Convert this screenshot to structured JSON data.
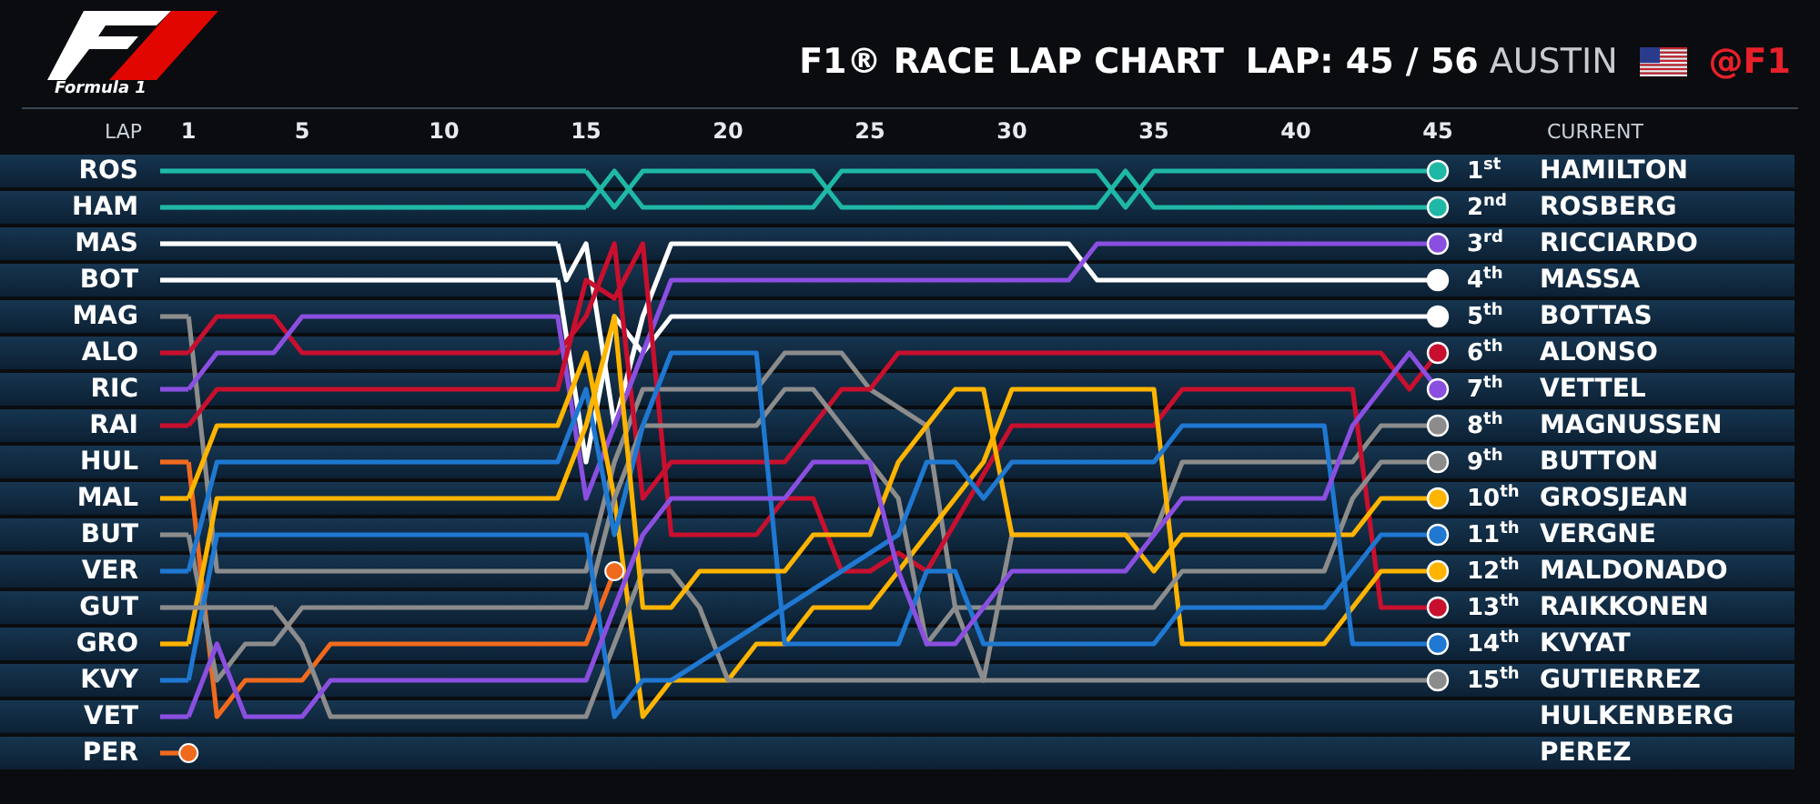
{
  "header": {
    "logo_caption": "Formula 1",
    "title": "F1® RACE LAP CHART",
    "lap_label": "LAP: 45 / 56",
    "venue": "AUSTIN",
    "handle": "@F1"
  },
  "chart": {
    "lap_heading": "LAP",
    "current_heading": "CURRENT",
    "lap_ticks": [
      "1",
      "5",
      "10",
      "15",
      "20",
      "25",
      "30",
      "35",
      "40",
      "45"
    ],
    "start_order": [
      {
        "code": "ROS",
        "color": "#1fb8a6"
      },
      {
        "code": "HAM",
        "color": "#1fb8a6"
      },
      {
        "code": "MAS",
        "color": "#ffffff"
      },
      {
        "code": "BOT",
        "color": "#ffffff"
      },
      {
        "code": "MAG",
        "color": "#8c8c8c"
      },
      {
        "code": "ALO",
        "color": "#c8102e"
      },
      {
        "code": "RIC",
        "color": "#8a4fe0"
      },
      {
        "code": "RAI",
        "color": "#c8102e"
      },
      {
        "code": "HUL",
        "color": "#f06a1e"
      },
      {
        "code": "MAL",
        "color": "#ffb400"
      },
      {
        "code": "BUT",
        "color": "#8c8c8c"
      },
      {
        "code": "VER",
        "color": "#1f78d1"
      },
      {
        "code": "GUT",
        "color": "#8c8c8c"
      },
      {
        "code": "GRO",
        "color": "#ffb400"
      },
      {
        "code": "KVY",
        "color": "#1f78d1"
      },
      {
        "code": "VET",
        "color": "#8a4fe0"
      },
      {
        "code": "PER",
        "color": "#f06a1e"
      }
    ],
    "standings": [
      {
        "position": "1$^{st}$",
        "name": "HAMILTON",
        "color": "#1fb8a6"
      },
      {
        "position": "2$^{nd}$",
        "name": "ROSBERG",
        "color": "#1fb8a6"
      },
      {
        "position": "3$^{rd}$",
        "name": "RICCIARDO",
        "color": "#8a4fe0"
      },
      {
        "position": "4$^{th}$",
        "name": "MASSA",
        "color": "#ffffff"
      },
      {
        "position": "5$^{th}$",
        "name": "BOTTAS",
        "color": "#ffffff"
      },
      {
        "position": "6$^{th}$",
        "name": "ALONSO",
        "color": "#c8102e"
      },
      {
        "position": "7$^{th}$",
        "name": "VETTEL",
        "color": "#8a4fe0"
      },
      {
        "position": "8$^{th}$",
        "name": "MAGNUSSEN",
        "color": "#8c8c8c"
      },
      {
        "position": "9$^{th}$",
        "name": "BUTTON",
        "color": "#8c8c8c"
      },
      {
        "position": "10$^{th}$",
        "name": "GROSJEAN",
        "color": "#ffb400"
      },
      {
        "position": "11$^{th}$",
        "name": "VERGNE",
        "color": "#1f78d1"
      },
      {
        "position": "12$^{th}$",
        "name": "MALDONADO",
        "color": "#ffb400"
      },
      {
        "position": "13$^{th}$",
        "name": "RAIKKONEN",
        "color": "#c8102e"
      },
      {
        "position": "14$^{th}$",
        "name": "KVYAT",
        "color": "#1f78d1"
      },
      {
        "position": "15$^{th}$",
        "name": "GUTIERREZ",
        "color": "#8c8c8c"
      },
      {
        "name": "HULKENBERG"
      },
      {
        "name": "PEREZ"
      }
    ]
  }
}
